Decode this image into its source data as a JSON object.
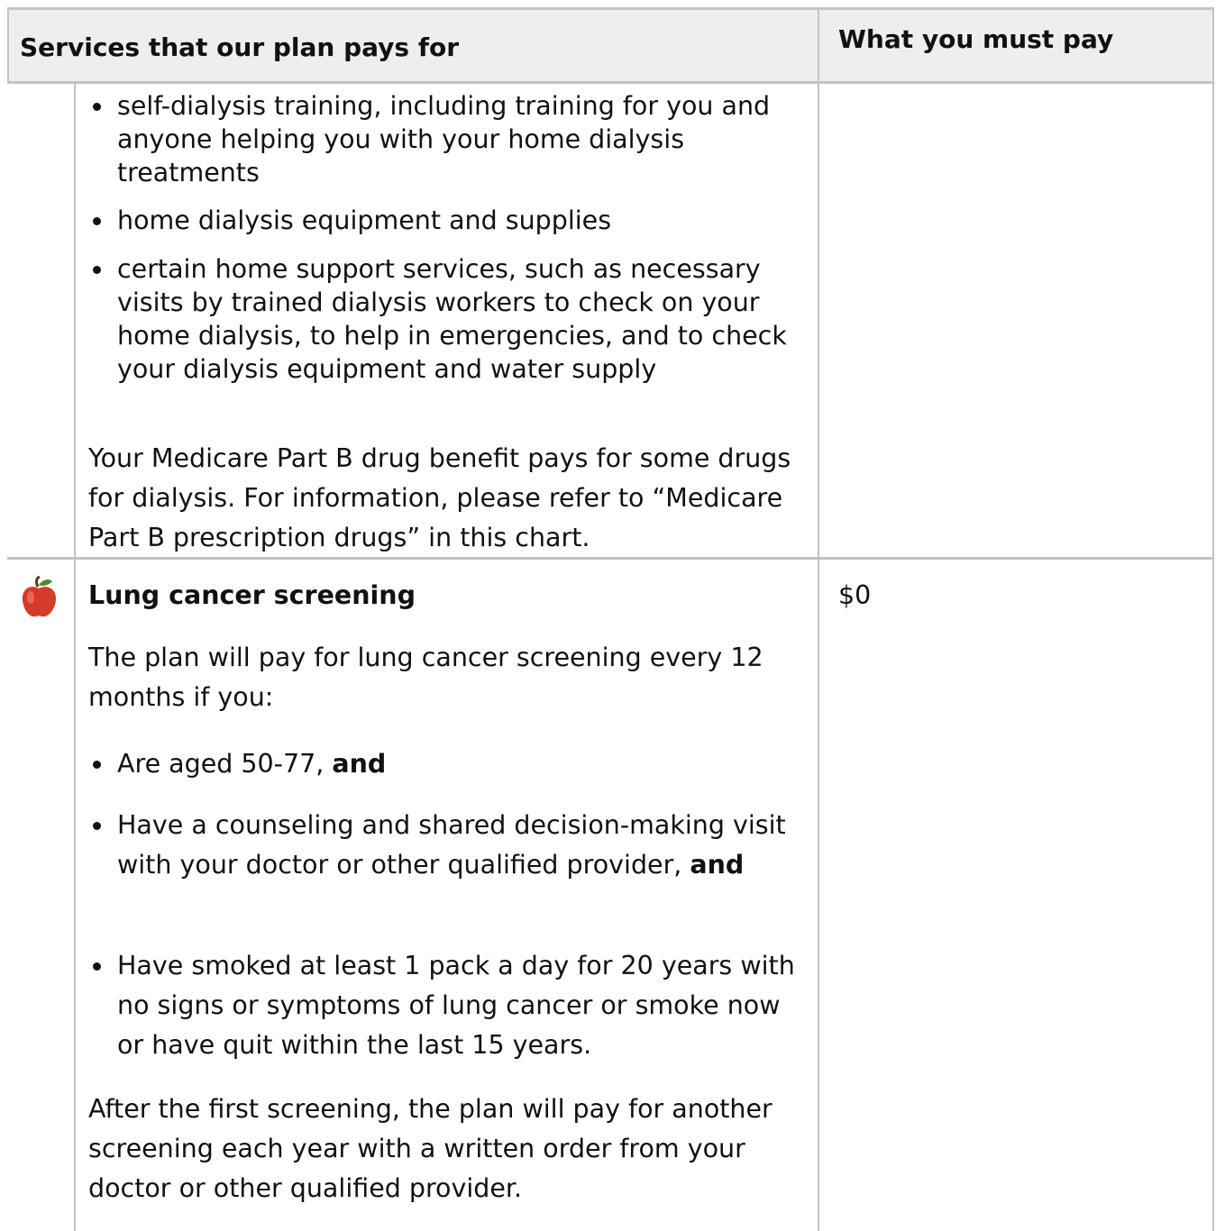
{
  "table_header": {
    "services_col": "Services that our plan pays for",
    "pay_col": "What you must pay"
  },
  "dialysis_continued": {
    "bullets": [
      "self-dialysis training, including training for you and anyone helping you with your home dialysis treatments",
      "home dialysis equipment and supplies",
      "certain home support services, such as necessary visits by trained dialysis workers to check on your home dialysis, to help in emergencies, and to check your dialysis equipment and water supply"
    ],
    "note": "Your Medicare Part B drug benefit pays for some drugs for dialysis. For information, please refer to “Medicare Part B prescription drugs” in this chart."
  },
  "lung_cancer": {
    "icon": "apple-icon",
    "title": "Lung cancer screening",
    "cost": "$0",
    "intro": "The plan will pay for lung cancer screening every 12 months if you:",
    "bullets": [
      {
        "text": "Are aged 50-77, ",
        "bold": "and"
      },
      {
        "text": "Have a counseling and shared decision-making visit with your doctor or other qualified provider, ",
        "bold": "and"
      },
      {
        "text": "Have smoked at least 1 pack a day for 20 years with no signs or symptoms of lung cancer or smoke now or have quit within the last 15 years.",
        "bold": ""
      }
    ],
    "followup": "After the first screening, the plan will pay for another screening each year with a written order from your doctor or other qualified provider."
  },
  "colors": {
    "border": "#c3c3c3",
    "header_bg": "#eeeeee",
    "apple": "#d63a28"
  }
}
